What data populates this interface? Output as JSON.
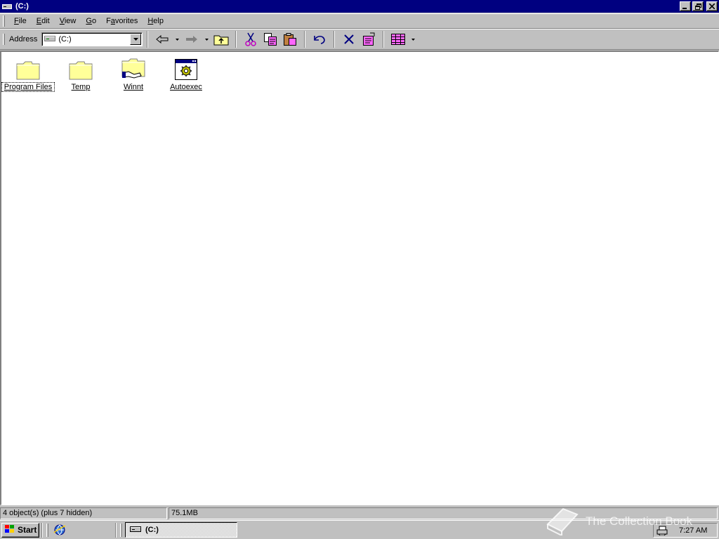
{
  "window": {
    "title": "(C:)"
  },
  "menu": [
    {
      "pre": "",
      "key": "F",
      "post": "ile"
    },
    {
      "pre": "",
      "key": "E",
      "post": "dit"
    },
    {
      "pre": "",
      "key": "V",
      "post": "iew"
    },
    {
      "pre": "",
      "key": "G",
      "post": "o"
    },
    {
      "pre": "F",
      "key": "a",
      "post": "vorites"
    },
    {
      "pre": "",
      "key": "H",
      "post": "elp"
    }
  ],
  "address": {
    "label": "Address",
    "value": "(C:)"
  },
  "items": [
    {
      "label": "Program Files",
      "icon": "folder-icon"
    },
    {
      "label": "Temp",
      "icon": "folder-icon"
    },
    {
      "label": "Winnt",
      "icon": "shared-folder-icon"
    },
    {
      "label": "Autoexec",
      "icon": "batch-file-icon"
    }
  ],
  "status": {
    "objects": "4 object(s) (plus 7 hidden)",
    "size": "75.1MB"
  },
  "taskbar": {
    "start": "Start",
    "task": "(C:)",
    "clock": "7:27 AM"
  },
  "watermark": "The Collection Book",
  "colors": {
    "titlebar": "#000080",
    "face": "#c0c0c0",
    "folder": "#ffff99"
  }
}
